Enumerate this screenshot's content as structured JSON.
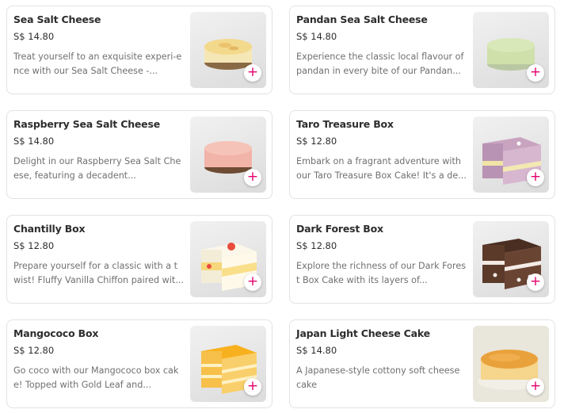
{
  "items": [
    {
      "name": "Sea Salt Cheese",
      "price": "S$ 14.80",
      "desc": "Treat yourself to an exquisite experi-ence with our Sea Salt Cheese -...",
      "icon": "plus-icon"
    },
    {
      "name": "Pandan Sea Salt Cheese",
      "price": "S$ 14.80",
      "desc": "Experience the classic local flavour of pandan in every bite of our Pandan...",
      "icon": "plus-icon"
    },
    {
      "name": "Raspberry Sea Salt Cheese",
      "price": "S$ 14.80",
      "desc": "Delight in our Raspberry Sea Salt Cheese, featuring a decadent...",
      "icon": "plus-icon"
    },
    {
      "name": "Taro Treasure Box",
      "price": "S$ 12.80",
      "desc": "Embark on a fragrant adventure with our Taro Treasure Box Cake! It's a de...",
      "icon": "plus-icon"
    },
    {
      "name": "Chantilly Box",
      "price": "S$ 12.80",
      "desc": "Prepare yourself for a classic with a twist! Fluffy Vanilla Chiffon paired wit...",
      "icon": "plus-icon"
    },
    {
      "name": "Dark Forest Box",
      "price": "S$ 12.80",
      "desc": "Explore the richness of our Dark Forest Box Cake with its layers of...",
      "icon": "plus-icon"
    },
    {
      "name": "Mangococo Box",
      "price": "S$ 12.80",
      "desc": "Go coco with our Mangococo box cake! Topped with Gold Leaf and...",
      "icon": "plus-icon"
    },
    {
      "name": "Japan Light Cheese Cake",
      "price": "S$ 14.80",
      "desc": "A Japanese-style cottony soft cheese cake",
      "icon": "plus-icon"
    }
  ],
  "add_symbol": "+",
  "colors": {
    "accent": "#e4006d",
    "title": "#2d2d2d",
    "desc": "#707070",
    "border": "#e2e2e2"
  }
}
